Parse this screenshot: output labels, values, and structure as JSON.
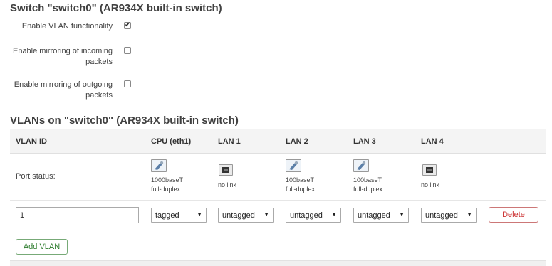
{
  "switch_section": {
    "title": "Switch \"switch0\" (AR934X built-in switch)",
    "options": [
      {
        "label": "Enable VLAN functionality",
        "checked": true
      },
      {
        "label": "Enable mirroring of incoming packets",
        "checked": false
      },
      {
        "label": "Enable mirroring of outgoing packets",
        "checked": false
      }
    ]
  },
  "vlans_section": {
    "title": "VLANs on \"switch0\" (AR934X built-in switch)",
    "headers": {
      "vlan_id": "VLAN ID",
      "cpu": "CPU (eth1)",
      "lan1": "LAN 1",
      "lan2": "LAN 2",
      "lan3": "LAN 3",
      "lan4": "LAN 4"
    },
    "port_status_label": "Port status:",
    "port_status": {
      "cpu": {
        "line1": "1000baseT",
        "line2": "full-duplex",
        "icon": "port-connected-icon"
      },
      "lan1": {
        "line1": "no link",
        "line2": "",
        "icon": "port-nolink-icon"
      },
      "lan2": {
        "line1": "100baseT",
        "line2": "full-duplex",
        "icon": "port-connected-icon"
      },
      "lan3": {
        "line1": "100baseT",
        "line2": "full-duplex",
        "icon": "port-connected-icon"
      },
      "lan4": {
        "line1": "no link",
        "line2": "",
        "icon": "port-nolink-icon"
      }
    },
    "row": {
      "vlan_id": "1",
      "cpu": "tagged",
      "lan1": "untagged",
      "lan2": "untagged",
      "lan3": "untagged",
      "lan4": "untagged"
    },
    "delete_label": "Delete",
    "add_label": "Add VLAN"
  }
}
